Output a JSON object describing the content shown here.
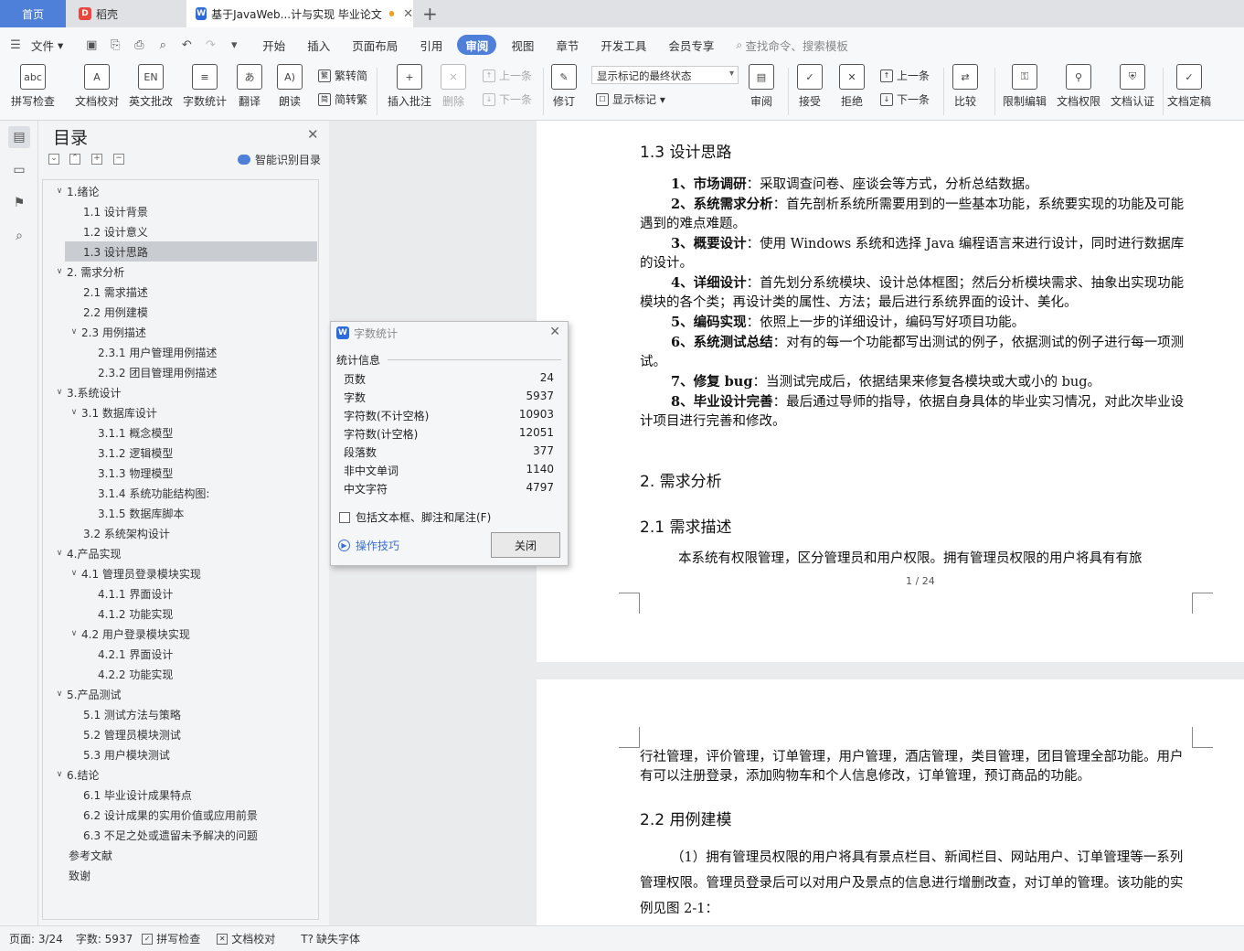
{
  "tabs": {
    "home": "首页",
    "daoke": "稻壳",
    "document": "基于JavaWeb...计与实现 毕业论文"
  },
  "menu": {
    "file": "文件",
    "items": [
      "开始",
      "插入",
      "页面布局",
      "引用",
      "审阅",
      "视图",
      "章节",
      "开发工具",
      "会员专享"
    ],
    "search_placeholder": "查找命令、搜索模板"
  },
  "ribbon": {
    "spell_check": "拼写检查",
    "doc_proof": "文档校对",
    "english_review": "英文批改",
    "word_count": "字数统计",
    "translate": "翻译",
    "read_aloud": "朗读",
    "trad_to_simp": "繁转简",
    "simp_to_trad": "简转繁",
    "insert_comment": "插入批注",
    "delete": "删除",
    "prev_comment": "上一条",
    "next_comment": "下一条",
    "revise": "修订",
    "markup_state": "显示标记的最终状态",
    "show_markup": "显示标记",
    "review": "审阅",
    "accept": "接受",
    "reject": "拒绝",
    "prev": "上一条",
    "next": "下一条",
    "compare": "比较",
    "restrict_edit": "限制编辑",
    "doc_rights": "文档权限",
    "doc_cert": "文档认证",
    "doc_final": "文档定稿"
  },
  "nav": {
    "title": "目录",
    "smart_toc": "智能识别目录",
    "toc": [
      {
        "label": "1.绪论",
        "level": 0,
        "arrow": true
      },
      {
        "label": "1.1 设计背景",
        "level": 1
      },
      {
        "label": "1.2 设计意义",
        "level": 1
      },
      {
        "label": "1.3 设计思路",
        "level": 1,
        "selected": true
      },
      {
        "label": "2. 需求分析",
        "level": 0,
        "arrow": true
      },
      {
        "label": "2.1  需求描述",
        "level": 1
      },
      {
        "label": "2.2  用例建模",
        "level": 1
      },
      {
        "label": "2.3  用例描述",
        "level": 1,
        "arrow": true
      },
      {
        "label": "2.3.1  用户管理用例描述",
        "level": 2
      },
      {
        "label": "2.3.2  团目管理用例描述",
        "level": 2
      },
      {
        "label": "3.系统设计",
        "level": 0,
        "arrow": true
      },
      {
        "label": "3.1  数据库设计",
        "level": 1,
        "arrow": true
      },
      {
        "label": "3.1.1  概念模型",
        "level": 2
      },
      {
        "label": "3.1.2  逻辑模型",
        "level": 2
      },
      {
        "label": "3.1.3  物理模型",
        "level": 2
      },
      {
        "label": "3.1.4  系统功能结构图:",
        "level": 2
      },
      {
        "label": "3.1.5  数据库脚本",
        "level": 2
      },
      {
        "label": "3.2  系统架构设计",
        "level": 1
      },
      {
        "label": "4.产品实现",
        "level": 0,
        "arrow": true
      },
      {
        "label": "4.1  管理员登录模块实现",
        "level": 1,
        "arrow": true
      },
      {
        "label": "4.1.1  界面设计",
        "level": 2
      },
      {
        "label": "4.1.2  功能实现",
        "level": 2
      },
      {
        "label": "4.2  用户登录模块实现",
        "level": 1,
        "arrow": true
      },
      {
        "label": "4.2.1  界面设计",
        "level": 2
      },
      {
        "label": "4.2.2  功能实现",
        "level": 2
      },
      {
        "label": "5.产品测试",
        "level": 0,
        "arrow": true
      },
      {
        "label": "5.1  测试方法与策略",
        "level": 1
      },
      {
        "label": "5.2 管理员模块测试",
        "level": 1
      },
      {
        "label": "5.3  用户模块测试",
        "level": 1
      },
      {
        "label": "6.结论",
        "level": 0,
        "arrow": true
      },
      {
        "label": "6.1 毕业设计成果特点",
        "level": 1
      },
      {
        "label": "6.2 设计成果的实用价值或应用前景",
        "level": 1
      },
      {
        "label": "6.3 不足之处或遗留未予解决的问题",
        "level": 1
      },
      {
        "label": "参考文献",
        "level": 0
      },
      {
        "label": "致谢",
        "level": 0
      }
    ]
  },
  "doc": {
    "h13": "1.3 设计思路",
    "items": [
      {
        "bold": "1、市场调研",
        "text": "：采取调查问卷、座谈会等方式，分析总结数据。"
      },
      {
        "bold": "2、系统需求分析",
        "text": "：首先剖析系统所需要用到的一些基本功能，系统要实现的功能及可能遇到的难点难题。"
      },
      {
        "bold": "3、概要设计",
        "text": "：使用 Windows 系统和选择 Java 编程语言来进行设计，同时进行数据库的设计。"
      },
      {
        "bold": "4、详细设计",
        "text": "：首先划分系统模块、设计总体框图；然后分析模块需求、抽象出实现功能模块的各个类；再设计类的属性、方法；最后进行系统界面的设计、美化。"
      },
      {
        "bold": "5、编码实现",
        "text": "：依照上一步的详细设计，编码写好项目功能。"
      },
      {
        "bold": "6、系统测试总结",
        "text": "：对有的每一个功能都写出测试的例子，依据测试的例子进行每一项测试。"
      },
      {
        "bold": "7、修复 bug",
        "text": "：当测试完成后，依据结果来修复各模块或大或小的 bug。"
      },
      {
        "bold": "8、毕业设计完善",
        "text": "：最后通过导师的指导，依据自身具体的毕业实习情况，对此次毕业设计项目进行完善和修改。"
      }
    ],
    "h2": "2.  需求分析",
    "h21": "2.1  需求描述",
    "p21": "本系统有权限管理，区分管理员和用户权限。拥有管理员权限的用户将具有有旅",
    "page_num": "1 / 24",
    "p2_cont": "行社管理，评价管理，订单管理，用户管理，酒店管理，类目管理，团目管理全部功能。用户有可以注册登录，添加购物车和个人信息修改，订单管理，预订商品的功能。",
    "h22": "2.2  用例建模",
    "p22": "（1）拥有管理员权限的用户将具有景点栏目、新闻栏目、网站用户、订单管理等一系列管理权限。管理员登录后可以对用户及景点的信息进行增删改查，对订单的管理。该功能的实例见图 2-1："
  },
  "dialog": {
    "title": "字数统计",
    "section": "统计信息",
    "stats": [
      {
        "label": "页数",
        "value": "24"
      },
      {
        "label": "字数",
        "value": "5937"
      },
      {
        "label": "字符数(不计空格)",
        "value": "10903"
      },
      {
        "label": "字符数(计空格)",
        "value": "12051"
      },
      {
        "label": "段落数",
        "value": "377"
      },
      {
        "label": "非中文单词",
        "value": "1140"
      },
      {
        "label": "中文字符",
        "value": "4797"
      }
    ],
    "checkbox": "包括文本框、脚注和尾注(F)",
    "tips": "操作技巧",
    "close": "关闭"
  },
  "status": {
    "page": "页面: 3/24",
    "words": "字数: 5937",
    "spell": "拼写检查",
    "proof": "文档校对",
    "missing_font": "缺失字体"
  }
}
